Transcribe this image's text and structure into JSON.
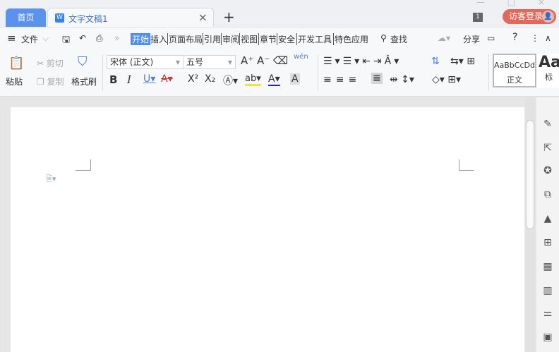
{
  "tabs": {
    "home": "首页",
    "doc": "文字文稿1",
    "doc_icon": "W",
    "close": "×",
    "new": "+"
  },
  "window": {
    "controls": "— □ ×"
  },
  "titlebar": {
    "count": "1",
    "login": "访客登录",
    "avatar": "👤"
  },
  "menu": {
    "hamburger": "≡",
    "file": "文件",
    "file_arrow": "⌵",
    "more": "»",
    "items": [
      "开始",
      "插入",
      "页面布局",
      "引用",
      "审阅",
      "视图",
      "章节",
      "安全",
      "开发工具",
      "特色应用"
    ],
    "search": "查找",
    "share": "分享",
    "help": "?",
    "kebab": "⋮",
    "collapse": "∧"
  },
  "ribbon": {
    "paste": "粘贴",
    "cut": "剪切",
    "copy": "复制",
    "format_painter": "格式刷",
    "font_name": "宋体 (正文)",
    "font_size": "五号",
    "styles": [
      {
        "preview": "AaBbCcDd",
        "name": "正文"
      },
      {
        "preview": "Aa",
        "name": "标"
      }
    ],
    "phonetic": "wén"
  },
  "sidebar": {
    "icons": [
      "pen-icon",
      "cursor-icon",
      "badge-icon",
      "shapes-icon",
      "stamp-icon",
      "table-icon",
      "apps-icon",
      "chart-icon",
      "sliders-icon",
      "image-icon"
    ]
  }
}
